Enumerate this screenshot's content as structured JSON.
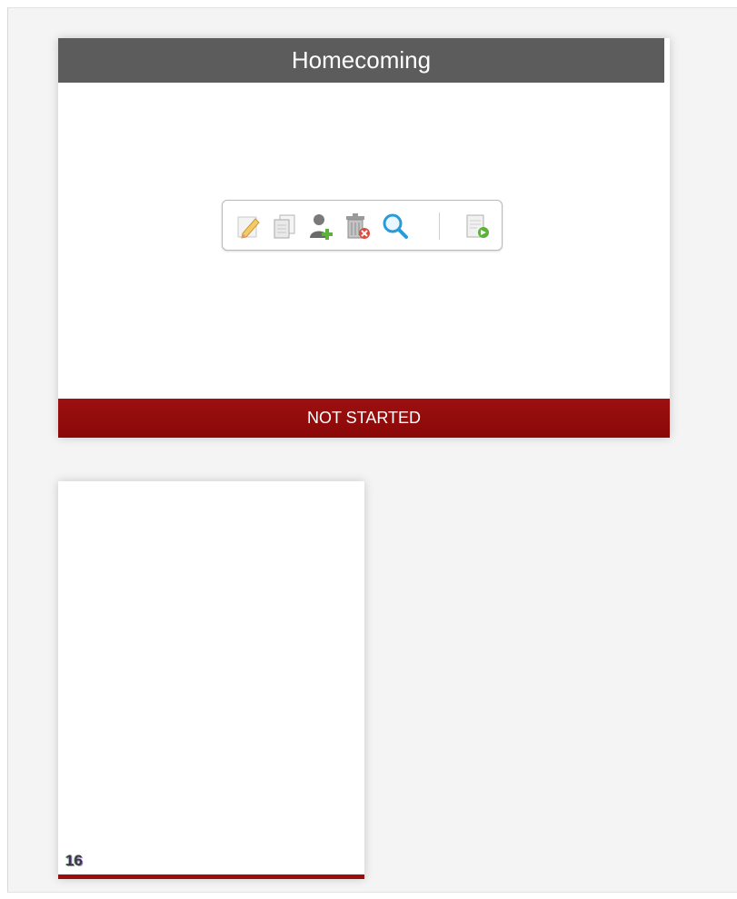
{
  "card_main": {
    "title": "Homecoming",
    "status": "NOT STARTED",
    "status_color": "#940b0b",
    "header_color": "#5c5c5c",
    "toolbar": {
      "buttons": [
        {
          "icon": "pencil-edit-icon",
          "action": "edit"
        },
        {
          "icon": "copy-pages-icon",
          "action": "copy"
        },
        {
          "icon": "add-user-icon",
          "action": "add-user"
        },
        {
          "icon": "trash-delete-icon",
          "action": "delete"
        },
        {
          "icon": "magnifier-icon",
          "action": "preview"
        },
        {
          "icon": "export-document-icon",
          "action": "export"
        }
      ]
    }
  },
  "card_small": {
    "count": "16"
  }
}
